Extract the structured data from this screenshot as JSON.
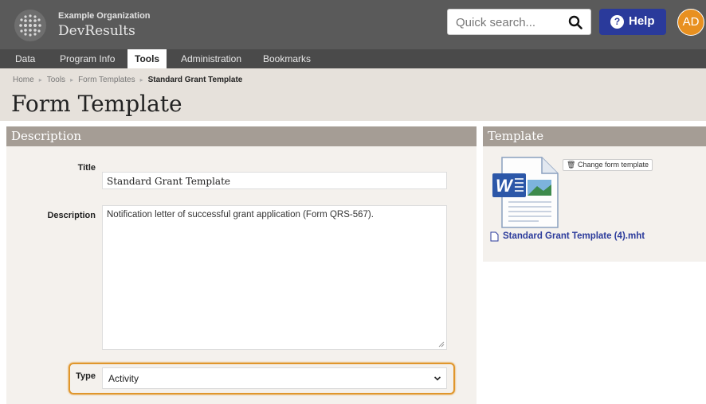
{
  "header": {
    "org_name": "Example Organization",
    "app_name": "DevResults",
    "search_placeholder": "Quick search...",
    "help_label": "Help",
    "avatar_initials": "AD"
  },
  "nav": {
    "items": [
      {
        "label": "Data",
        "active": false
      },
      {
        "label": "Program Info",
        "active": false
      },
      {
        "label": "Tools",
        "active": true
      },
      {
        "label": "Administration",
        "active": false
      },
      {
        "label": "Bookmarks",
        "active": false
      }
    ]
  },
  "breadcrumb": [
    "Home",
    "Tools",
    "Form Templates",
    "Standard Grant Template"
  ],
  "page_title": "Form Template",
  "description_panel": {
    "heading": "Description",
    "title_label": "Title",
    "title_value": "Standard Grant Template",
    "description_label": "Description",
    "description_value": "Notification letter of successful grant application (Form QRS-567).",
    "type_label": "Type",
    "type_value": "Activity"
  },
  "template_panel": {
    "heading": "Template",
    "change_button_label": "Change form template",
    "file_name": "Standard Grant Template (4).mht"
  },
  "colors": {
    "header_bg": "#5a5a5a",
    "nav_bg": "#4a4a4a",
    "help_button": "#2a3a9b",
    "avatar": "#e89020",
    "panel_heading": "#a59d95",
    "highlight": "#e0962c"
  }
}
